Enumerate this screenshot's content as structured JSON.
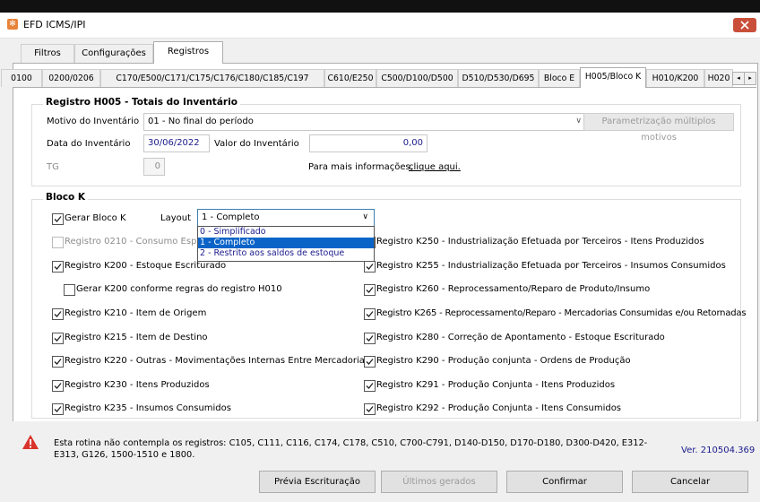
{
  "window": {
    "title": "EFD ICMS/IPI",
    "app_icon": "efd-app-icon",
    "close_icon": "close-icon"
  },
  "outer_tabs": [
    {
      "label": "Filtros"
    },
    {
      "label": "Configurações"
    },
    {
      "label": "Registros",
      "active": true
    }
  ],
  "inner_tabs": [
    {
      "label": "0100"
    },
    {
      "label": "0200/0206"
    },
    {
      "label": "C170/E500/C171/C175/C176/C180/C185/C197"
    },
    {
      "label": "C610/E250"
    },
    {
      "label": "C500/D100/D500"
    },
    {
      "label": "D510/D530/D695"
    },
    {
      "label": "Bloco E"
    },
    {
      "label": "H005/Bloco K",
      "active": true
    },
    {
      "label": "H010/K200"
    },
    {
      "label": "H020"
    }
  ],
  "h005": {
    "title": "Registro H005 - Totais do Inventário",
    "motivo_label": "Motivo do Inventário",
    "motivo_value": "01 - No final do período",
    "parametrizacao_button": "Parametrização múltiplos motivos",
    "data_label": "Data do Inventário",
    "data_value": "30/06/2022",
    "valor_label": "Valor do Inventário",
    "valor_value": "0,00",
    "tg_label": "TG",
    "tg_value": "0",
    "info_text": "Para mais informações,",
    "info_link": "clique aqui."
  },
  "bloco_k": {
    "title": "Bloco K",
    "gerar_label": "Gerar Bloco K",
    "layout_label": "Layout",
    "layout_value": "1 - Completo",
    "layout_options": [
      "0 - Simplificado",
      "1 - Completo",
      "2 - Restrito aos saldos de estoque"
    ],
    "layout_selected_index": 1,
    "left_items": [
      {
        "label": "Registro 0210 - Consumo Específico Padronizado",
        "checked": false,
        "disabled": true
      },
      {
        "label": "Registro K200 - Estoque Escriturado",
        "checked": true
      },
      {
        "label": "Gerar K200 conforme regras do registro H010",
        "checked": false,
        "indent": true
      },
      {
        "label": "Registro K210 - Item de Origem",
        "checked": true
      },
      {
        "label": "Registro K215 - Item de Destino",
        "checked": true
      },
      {
        "label": "Registro K220 - Outras - Movimentações Internas Entre Mercadorias",
        "checked": true
      },
      {
        "label": "Registro K230 - Itens Produzidos",
        "checked": true
      },
      {
        "label": "Registro K235 - Insumos Consumidos",
        "checked": true
      }
    ],
    "right_items": [
      {
        "label": "Registro K250 - Industrialização Efetuada por Terceiros - Itens Produzidos",
        "checked": true
      },
      {
        "label": "Registro K255 - Industrialização Efetuada por Terceiros - Insumos Consumidos",
        "checked": true
      },
      {
        "label": "Registro K260 - Reprocessamento/Reparo de Produto/Insumo",
        "checked": true
      },
      {
        "label": "Registro K265 - Reprocessamento/Reparo - Mercadorias Consumidas e/ou Retornadas",
        "checked": true
      },
      {
        "label": "Registro K280 - Correção de Apontamento - Estoque Escriturado",
        "checked": true
      },
      {
        "label": "Registro K290 - Produção conjunta - Ordens de Produção",
        "checked": true
      },
      {
        "label": "Registro K291 - Produção Conjunta - Itens Produzidos",
        "checked": true
      },
      {
        "label": "Registro K292 - Produção Conjunta - Itens Consumidos",
        "checked": true
      }
    ]
  },
  "footer": {
    "warning_icon": "warning-icon",
    "info": "Esta rotina não contempla os registros: C105, C111, C116, C174, C178, C510, C700-C791, D140-D150, D170-D180, D300-D420, E312-E313, G126, 1500-1510 e 1800.",
    "version": "Ver. 210504.369",
    "buttons": {
      "previa": "Prévia Escrituração",
      "ultimos": "Últimos gerados",
      "confirmar": "Confirmar",
      "cancelar": "Cancelar"
    }
  }
}
